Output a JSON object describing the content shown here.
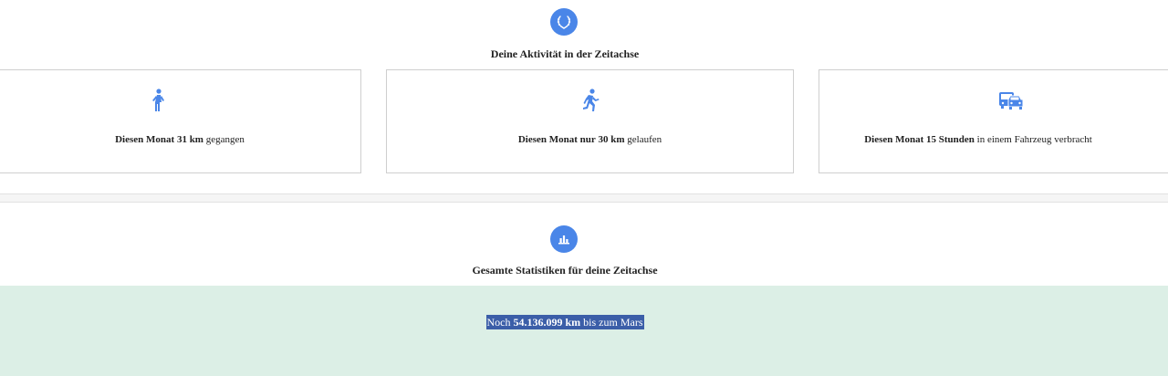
{
  "activity": {
    "title": "Deine Aktivität in der Zeitachse",
    "icon": "laurel-wreath-icon",
    "cards": [
      {
        "icon": "walking-icon",
        "prefix": "Diesen Monat",
        "value": "31 km",
        "suffix": "gegangen"
      },
      {
        "icon": "running-icon",
        "prefix": "Diesen Monat nur",
        "value": "30 km",
        "suffix": "gelaufen"
      },
      {
        "icon": "vehicle-icon",
        "prefix": "Diesen Monat",
        "value": "15 Stunden",
        "suffix": "in einem Fahrzeug verbracht"
      }
    ]
  },
  "stats": {
    "title": "Gesamte Statistiken für deine Zeitachse",
    "icon": "bar-chart-icon",
    "mars": {
      "prefix": "Noch",
      "value": "54.136.099 km",
      "suffix": "bis zum Mars"
    }
  },
  "colors": {
    "accent": "#4a86e8",
    "green_band": "#dcefe6",
    "highlight": "#3b5ea8"
  }
}
